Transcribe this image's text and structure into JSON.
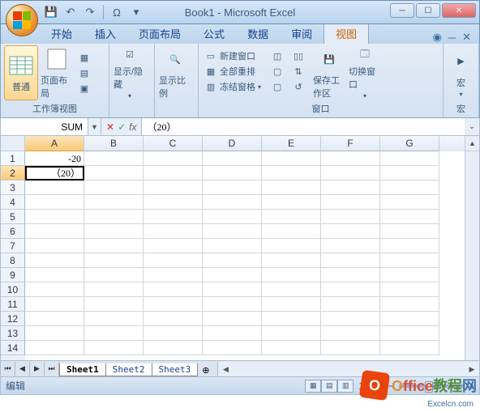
{
  "title": "Book1 - Microsoft Excel",
  "qat": {
    "save": "💾",
    "undo": "↶",
    "redo": "↷",
    "omega": "Ω"
  },
  "tabs": [
    "开始",
    "插入",
    "页面布局",
    "公式",
    "数据",
    "审阅",
    "视图"
  ],
  "active_tab": "视图",
  "ribbon": {
    "group1": {
      "label": "工作簿视图",
      "normal": "普通",
      "pagelayout": "页面布局",
      "extra": "▾"
    },
    "group2": {
      "btn": "显示/隐藏",
      "arrow": "▾"
    },
    "group3": {
      "btn": "显示比例"
    },
    "group4": {
      "label": "窗口",
      "new_window": "新建窗口",
      "arrange": "全部重排",
      "freeze": "冻结窗格",
      "save_ws": "保存工作区",
      "switch": "切换窗口"
    },
    "group5": {
      "label": "宏",
      "btn": "宏"
    }
  },
  "name_box": "SUM",
  "formula": "（20）",
  "fx": {
    "cancel": "✕",
    "enter": "✓",
    "fx": "fx"
  },
  "columns": [
    "A",
    "B",
    "C",
    "D",
    "E",
    "F",
    "G"
  ],
  "active_col": "A",
  "rows": [
    "1",
    "2",
    "3",
    "4",
    "5",
    "6",
    "7",
    "8",
    "9",
    "10",
    "11",
    "12",
    "13",
    "14"
  ],
  "active_row": "2",
  "cells": {
    "A1": "-20",
    "A2": "（20）"
  },
  "sheets": [
    "Sheet1",
    "Sheet2",
    "Sheet3"
  ],
  "active_sheet": "Sheet1",
  "status": "编辑",
  "zoom": "100%",
  "watermark": {
    "brand": "Office教程网",
    "url": "Excelcn.com"
  }
}
